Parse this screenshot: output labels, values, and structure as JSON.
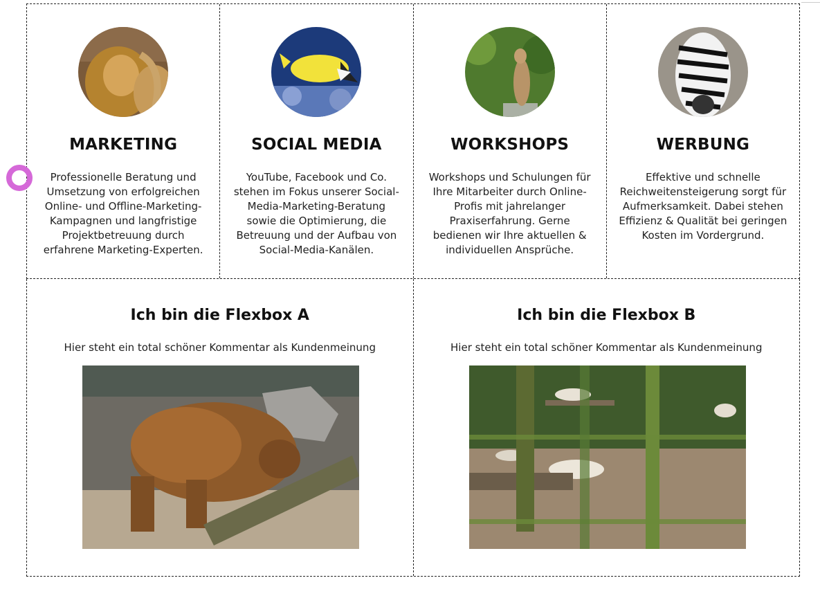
{
  "services": [
    {
      "title": "MARKETING",
      "text": "Professionelle Beratung und Umsetzung von erfolgreichen Online- und Offline-Marketing-Kampagnen und langfristige Projektbetreuung durch erfahrene Marketing-Experten.",
      "image": "lion-photo"
    },
    {
      "title": "SOCIAL MEDIA",
      "text": "YouTube, Facebook und Co. stehen im Fokus unserer Social-Media-Marketing-Beratung sowie die Optimierung, die Betreuung und der Aufbau von Social-Media-Kanälen.",
      "image": "fish-photo"
    },
    {
      "title": "WORKSHOPS",
      "text": "Workshops und Schulungen für Ihre Mitarbeiter durch Online-Profis mit jahrelanger Praxiserfahrung. Gerne bedienen wir Ihre aktuellen & individuellen Ansprüche.",
      "image": "meerkat-photo"
    },
    {
      "title": "WERBUNG",
      "text": "Effektive und schnelle Reichweitensteigerung sorgt für Aufmerksamkeit. Dabei stehen Effizienz & Qualität bei geringen Kosten im Vordergrund.",
      "image": "zebra-photo"
    }
  ],
  "flexboxes": [
    {
      "title": "Ich bin die Flexbox A",
      "comment": "Hier steht ein total schöner Kommentar als Kundenmeinung",
      "image": "bear-photo"
    },
    {
      "title": "Ich bin die Flexbox B",
      "comment": "Hier steht ein total schöner Kommentar als Kundenmeinung",
      "image": "wolves-photo"
    }
  ],
  "colors": {
    "cursor": "#d569d8",
    "border": "#222222"
  }
}
